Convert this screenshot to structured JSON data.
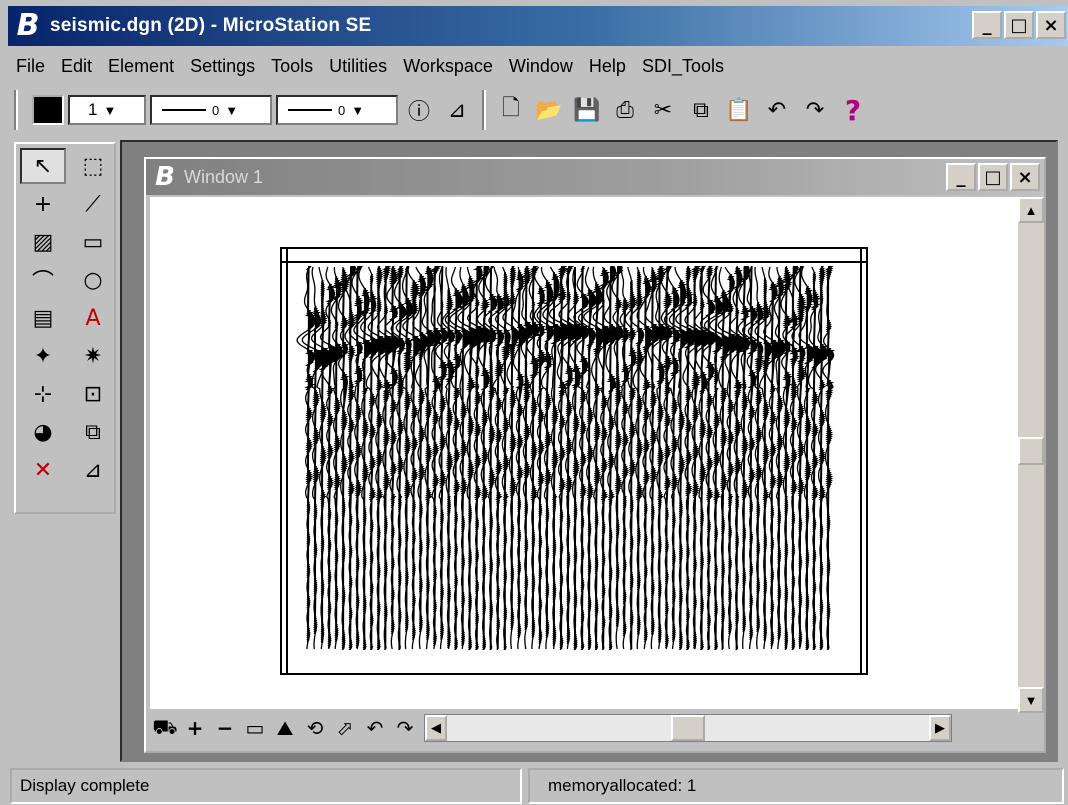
{
  "app": {
    "title": "seismic.dgn (2D) - MicroStation SE",
    "controls": {
      "minimize": "_",
      "maximize": "□",
      "close": "×"
    }
  },
  "menu": [
    "File",
    "Edit",
    "Element",
    "Settings",
    "Tools",
    "Utilities",
    "Workspace",
    "Window",
    "Help",
    "SDI_Tools"
  ],
  "toolbar": {
    "color": "#000000",
    "weight_value": "1",
    "line_style_value": "0",
    "line_weight_value": "0",
    "icons": [
      "info-icon",
      "tentative-icon",
      "new-file-icon",
      "open-file-icon",
      "save-icon",
      "print-icon",
      "cut-icon",
      "copy-icon",
      "paste-icon",
      "undo-icon",
      "redo-icon",
      "help-icon"
    ]
  },
  "toolbox": {
    "tools": [
      {
        "name": "select-element-tool",
        "glyph": "↖",
        "active": true
      },
      {
        "name": "fence-tool",
        "glyph": "⬚"
      },
      {
        "name": "place-point-tool",
        "glyph": "+"
      },
      {
        "name": "smartline-tool",
        "glyph": "⟋"
      },
      {
        "name": "hatch-tool",
        "glyph": "▨"
      },
      {
        "name": "rectangle-tool",
        "glyph": "▭"
      },
      {
        "name": "arc-tool",
        "glyph": "⌒"
      },
      {
        "name": "circle-tool",
        "glyph": "○"
      },
      {
        "name": "cell-tool",
        "glyph": "▤"
      },
      {
        "name": "text-tool",
        "glyph": "A",
        "red": true
      },
      {
        "name": "snap-tool",
        "glyph": "✦"
      },
      {
        "name": "manipulate-tool",
        "glyph": "✷"
      },
      {
        "name": "measure-tool",
        "glyph": "⊹"
      },
      {
        "name": "dimension-tool",
        "glyph": "⊡"
      },
      {
        "name": "palette-tool",
        "glyph": "◕"
      },
      {
        "name": "copy-element-tool",
        "glyph": "⧉"
      },
      {
        "name": "delete-tool",
        "glyph": "✕",
        "red": true
      },
      {
        "name": "scale-tool",
        "glyph": "⊿"
      }
    ]
  },
  "view_window": {
    "title": "Window 1",
    "view_controls": [
      "update-icon",
      "zoom-in-icon",
      "zoom-out-icon",
      "window-area-icon",
      "fit-view-icon",
      "rotate-view-icon",
      "pan-icon",
      "view-previous-icon",
      "view-next-icon"
    ],
    "traces": 75
  },
  "status": {
    "message": "Display complete",
    "memory": "memoryallocated: 1"
  }
}
